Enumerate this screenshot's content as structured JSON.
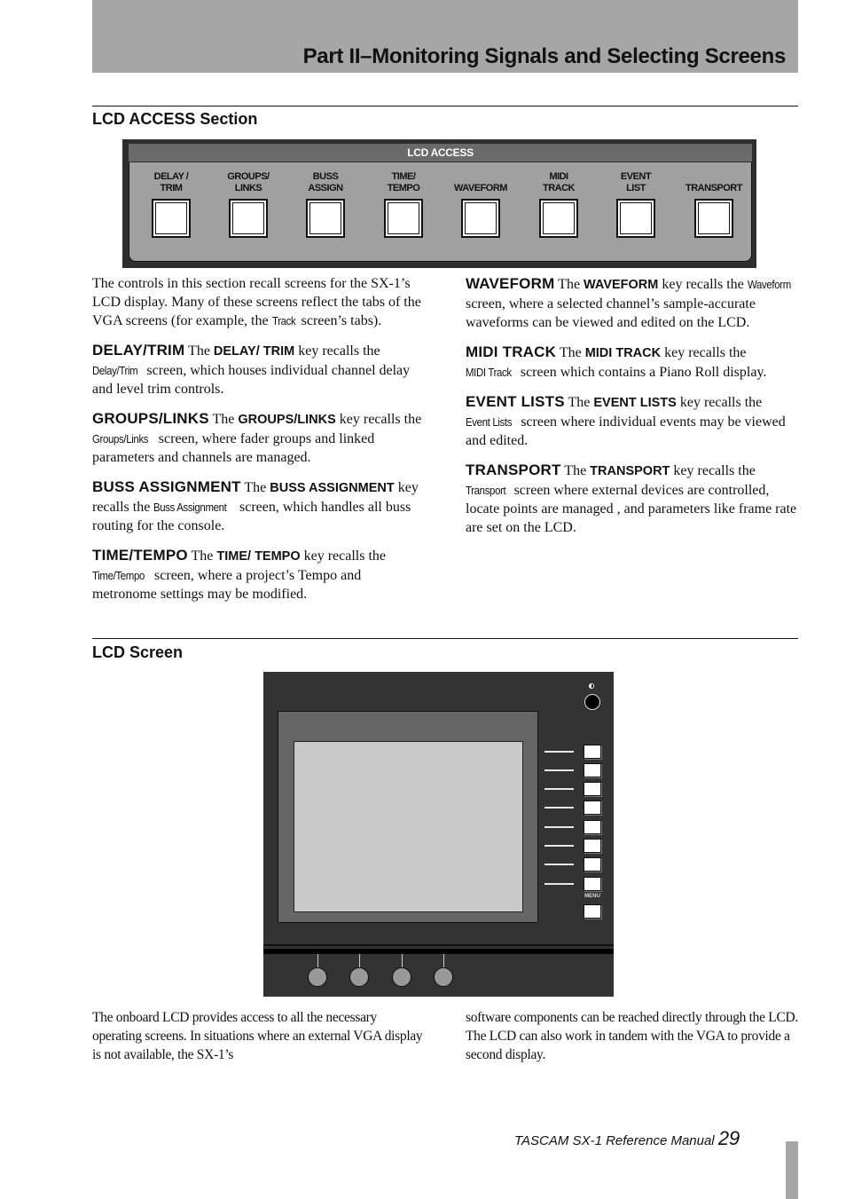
{
  "header": {
    "title": "Part II–Monitoring Signals and Selecting Screens"
  },
  "section1": {
    "heading": "LCD ACCESS Section",
    "panel": {
      "title": "LCD ACCESS",
      "keys": [
        {
          "line1": "DELAY /",
          "line2": "TRIM"
        },
        {
          "line1": "GROUPS/",
          "line2": "LINKS"
        },
        {
          "line1": "BUSS",
          "line2": "ASSIGN"
        },
        {
          "line1": "TIME/",
          "line2": "TEMPO"
        },
        {
          "line1": "",
          "line2": "WAVEFORM"
        },
        {
          "line1": "MIDI",
          "line2": "TRACK"
        },
        {
          "line1": "EVENT",
          "line2": "LIST"
        },
        {
          "line1": "",
          "line2": "TRANSPORT"
        }
      ]
    },
    "intro": {
      "part1": "The controls in this section recall screens for the SX-1’s LCD display. Many of these screens reflect the tabs of the VGA screens (for example, the ",
      "screen": "Track",
      "part2": " screen’s tabs)."
    },
    "entries": [
      {
        "term": "DELAY/TRIM",
        "pre": " The ",
        "key": "DELAY/ TRIM",
        "mid": " key recalls the ",
        "screen": "Delay/Trim",
        "post": " screen, which houses individual channel delay and level trim controls."
      },
      {
        "term": "GROUPS/LINKS",
        "pre": " The ",
        "key": "GROUPS/LINKS",
        "mid": " key recalls the ",
        "screen": "Groups/Links",
        "post": " screen, where fader groups and linked parameters and channels are managed."
      },
      {
        "term": "BUSS ASSIGNMENT",
        "pre": " The ",
        "key": "BUSS ASSIGNMENT",
        "mid": " key recalls the ",
        "screen": "Buss Assignment",
        "post": " screen, which handles all buss routing for the console."
      },
      {
        "term": "TIME/TEMPO",
        "pre": " The ",
        "key": "TIME/ TEMPO",
        "mid": " key recalls the ",
        "screen": "Time/Tempo",
        "post": " screen, where a project’s Tempo and metronome settings may be modified."
      },
      {
        "term": "WAVEFORM",
        "pre": " The ",
        "key": "WAVEFORM",
        "mid": " key recalls the ",
        "screen": "Waveform",
        "post": " screen, where a selected channel’s sample-accurate waveforms can be viewed and edited on the LCD."
      },
      {
        "term": "MIDI TRACK",
        "pre": " The ",
        "key": "MIDI TRACK",
        "mid": " key recalls the ",
        "screen": "MIDI Track",
        "post": " screen which contains a Piano Roll display."
      },
      {
        "term": "EVENT LISTS",
        "pre": " The ",
        "key": "EVENT LISTS",
        "mid": " key recalls the ",
        "screen": "Event Lists",
        "post": " screen where individual events may be viewed and edited."
      },
      {
        "term": "TRANSPORT",
        "pre": " The ",
        "key": "TRANSPORT",
        "mid": " key recalls the ",
        "screen": "Transport",
        "post": " screen where external devices are controlled, locate points are managed , and parameters like frame rate are set on the LCD."
      }
    ]
  },
  "section2": {
    "heading": "LCD Screen",
    "figure": {
      "menu_label": "MENU",
      "soft_key_count": 8,
      "encoder_count": 4
    },
    "para_left": "The onboard LCD provides access to all the necessary operating screens. In situations where an external VGA display is not available, the SX-1’s",
    "para_right": "software components can be reached directly through the LCD. The LCD can also work in tandem with the VGA to provide a second display."
  },
  "footer": {
    "manual": "TASCAM SX-1 Reference Manual ",
    "page": "29"
  }
}
